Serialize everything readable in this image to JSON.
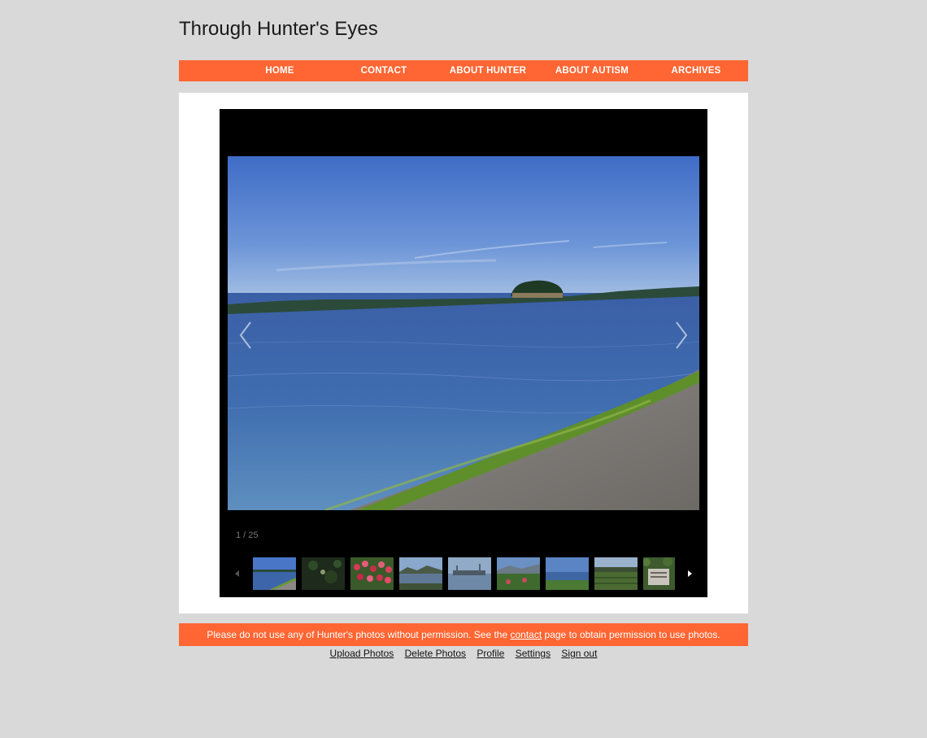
{
  "site": {
    "title": "Through Hunter's Eyes"
  },
  "nav": {
    "items": [
      {
        "label": "HOME"
      },
      {
        "label": "CONTACT"
      },
      {
        "label": "ABOUT HUNTER"
      },
      {
        "label": "ABOUT AUTISM"
      },
      {
        "label": "ARCHIVES"
      }
    ]
  },
  "slideshow": {
    "counter": "1 / 25",
    "current_index": 1,
    "total": 25,
    "photo_subject": "lake shoreline with small island",
    "thumbnails": [
      {
        "subject": "lake-shore"
      },
      {
        "subject": "dark-foliage"
      },
      {
        "subject": "red-tulips"
      },
      {
        "subject": "lake-hills"
      },
      {
        "subject": "waterfront"
      },
      {
        "subject": "garden-mountain"
      },
      {
        "subject": "lake-field"
      },
      {
        "subject": "garden-rows"
      },
      {
        "subject": "sign-foliage"
      }
    ]
  },
  "footer": {
    "notice_before": "Please do not use any of Hunter's photos without permission. See the ",
    "notice_link": "contact",
    "notice_after": " page to obtain permission to use photos.",
    "links": [
      {
        "label": "Upload Photos"
      },
      {
        "label": "Delete Photos"
      },
      {
        "label": "Profile"
      },
      {
        "label": "Settings"
      },
      {
        "label": "Sign out"
      }
    ]
  },
  "colors": {
    "accent": "#ff6633",
    "page_background": "#d9d9d9",
    "slideshow_background": "#000000"
  }
}
